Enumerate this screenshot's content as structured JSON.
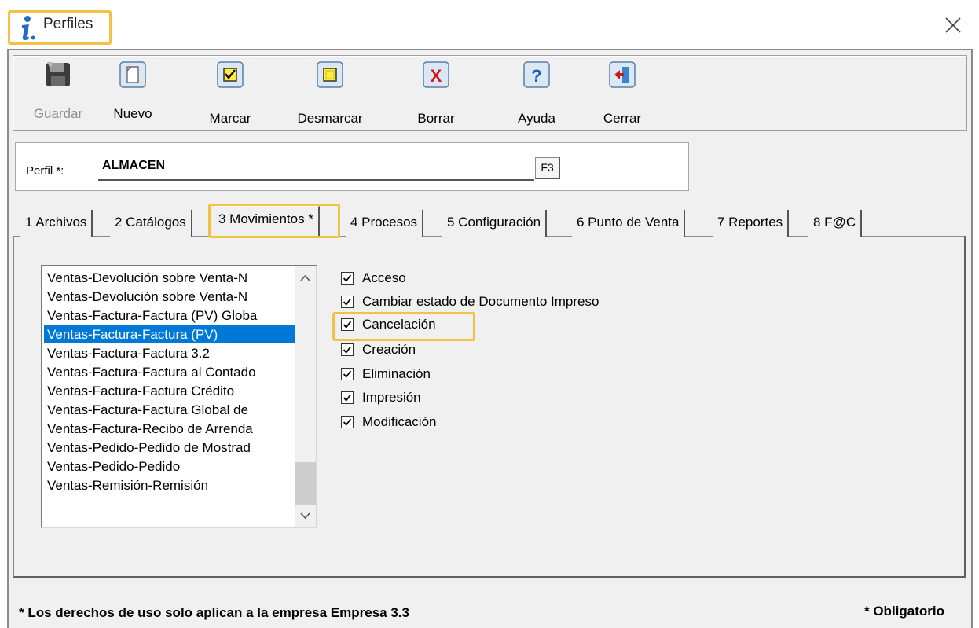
{
  "window": {
    "title": "Perfiles",
    "close_icon": "close-icon"
  },
  "toolbar": {
    "buttons": [
      {
        "id": "guardar",
        "label": "Guardar",
        "icon": "save-disk-icon",
        "enabled": false
      },
      {
        "id": "nuevo",
        "label": "Nuevo",
        "icon": "new-document-icon",
        "enabled": true
      },
      {
        "id": "marcar",
        "label": "Marcar",
        "icon": "check-mark-icon",
        "enabled": true
      },
      {
        "id": "desmarcar",
        "label": "Desmarcar",
        "icon": "uncheck-icon",
        "enabled": true
      },
      {
        "id": "borrar",
        "label": "Borrar",
        "icon": "delete-x-icon",
        "enabled": true
      },
      {
        "id": "ayuda",
        "label": "Ayuda",
        "icon": "help-question-icon",
        "enabled": true
      },
      {
        "id": "cerrar",
        "label": "Cerrar",
        "icon": "exit-door-icon",
        "enabled": true
      }
    ]
  },
  "perfil": {
    "label": "Perfil *:",
    "value": "ALMACEN",
    "lookup_button": "F3"
  },
  "tabs": [
    {
      "label": "1 Archivos",
      "active": false
    },
    {
      "label": "2 Catálogos",
      "active": false
    },
    {
      "label": "3 Movimientos *",
      "active": true
    },
    {
      "label": "4 Procesos",
      "active": false
    },
    {
      "label": "5 Configuración",
      "active": false
    },
    {
      "label": "6 Punto de Venta",
      "active": false
    },
    {
      "label": "7 Reportes",
      "active": false
    },
    {
      "label": "8 F@C",
      "active": false
    }
  ],
  "documents_list": {
    "items": [
      "Ventas-Devolución sobre Venta-N",
      "Ventas-Devolución sobre Venta-N",
      "Ventas-Factura-Factura (PV) Globa",
      "Ventas-Factura-Factura (PV)",
      "Ventas-Factura-Factura 3.2",
      "Ventas-Factura-Factura al Contado",
      "Ventas-Factura-Factura Crédito",
      "Ventas-Factura-Factura Global de",
      "Ventas-Factura-Recibo de Arrenda",
      "Ventas-Pedido-Pedido de Mostrad",
      "Ventas-Pedido-Pedido",
      "Ventas-Remisión-Remisión"
    ],
    "selected_index": 3
  },
  "permissions": [
    {
      "label": "Acceso",
      "checked": true
    },
    {
      "label": "Cambiar estado de Documento Impreso",
      "checked": true
    },
    {
      "label": "Cancelación",
      "checked": true
    },
    {
      "label": "Creación",
      "checked": true
    },
    {
      "label": "Eliminación",
      "checked": true
    },
    {
      "label": "Impresión",
      "checked": true
    },
    {
      "label": "Modificación",
      "checked": true
    }
  ],
  "footer": {
    "note": "* Los derechos de uso solo aplican a la empresa Empresa 3.3",
    "required": "* Obligatorio"
  },
  "colors": {
    "highlight": "#f4c243",
    "selection": "#0078d7"
  }
}
